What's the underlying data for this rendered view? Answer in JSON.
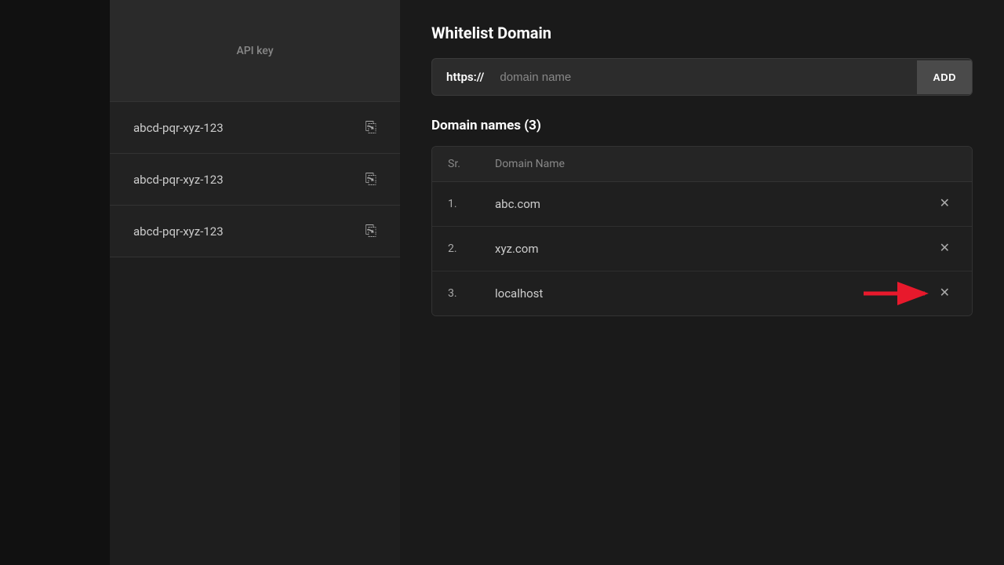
{
  "left_panel": {
    "background": "#111111"
  },
  "middle_panel": {
    "header": {
      "label": "API key"
    },
    "api_keys": [
      {
        "id": 1,
        "value": "abcd-pqr-xyz-123"
      },
      {
        "id": 2,
        "value": "abcd-pqr-xyz-123"
      },
      {
        "id": 3,
        "value": "abcd-pqr-xyz-123"
      }
    ]
  },
  "main_content": {
    "whitelist_section": {
      "title": "Whitelist Domain",
      "input": {
        "prefix": "https://",
        "placeholder": "domain name"
      },
      "add_button_label": "ADD"
    },
    "domain_names_section": {
      "title": "Domain names",
      "count": 3,
      "table": {
        "columns": [
          {
            "key": "sr",
            "label": "Sr."
          },
          {
            "key": "domain",
            "label": "Domain Name"
          }
        ],
        "rows": [
          {
            "sr": "1.",
            "domain": "abc.com"
          },
          {
            "sr": "2.",
            "domain": "xyz.com"
          },
          {
            "sr": "3.",
            "domain": "localhost"
          }
        ]
      }
    }
  }
}
